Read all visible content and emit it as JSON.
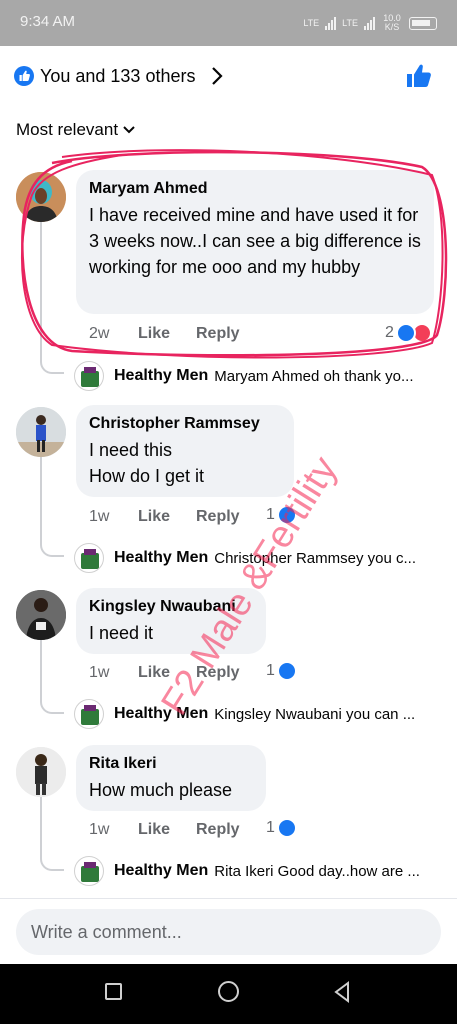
{
  "status_bar": {
    "time": "9:34 AM",
    "network_1": "LTE",
    "network_2": "LTE",
    "speed": "10.0 K/S"
  },
  "reactions": {
    "text": "You and 133 others"
  },
  "sort": {
    "label": "Most relevant"
  },
  "comments": [
    {
      "author": "Maryam Ahmed",
      "text": "I have received mine and have used it for 3 weeks now..I can see a big difference is working for me ooo and my hubby",
      "time": "2w",
      "like": "Like",
      "reply": "Reply",
      "reaction_count": "2",
      "reply_preview": {
        "author": "Healthy Men",
        "text": "Maryam Ahmed oh thank yo..."
      }
    },
    {
      "author": "Christopher Rammsey",
      "text": "I need this How do I get it",
      "text_line1": "I need this",
      "text_line2": "How do I get it",
      "time": "1w",
      "like": "Like",
      "reply": "Reply",
      "reaction_count": "1",
      "reply_preview": {
        "author": "Healthy Men",
        "text": "Christopher Rammsey you c..."
      }
    },
    {
      "author": "Kingsley Nwaubani",
      "text": "I need it",
      "time": "1w",
      "like": "Like",
      "reply": "Reply",
      "reaction_count": "1",
      "reply_preview": {
        "author": "Healthy Men",
        "text": "Kingsley Nwaubani you can ..."
      }
    },
    {
      "author": "Rita Ikeri",
      "text": "How much please",
      "time": "1w",
      "like": "Like",
      "reply": "Reply",
      "reaction_count": "1",
      "reply_preview": {
        "author": "Healthy Men",
        "text": "Rita Ikeri Good day..how are ..."
      }
    }
  ],
  "composer": {
    "placeholder": "Write a comment..."
  },
  "watermark": "F2 Male &Fertility",
  "colors": {
    "accent": "#1877f2",
    "love": "#f33e58",
    "highlight": "#e8245f",
    "bubble": "#f0f2f5"
  }
}
